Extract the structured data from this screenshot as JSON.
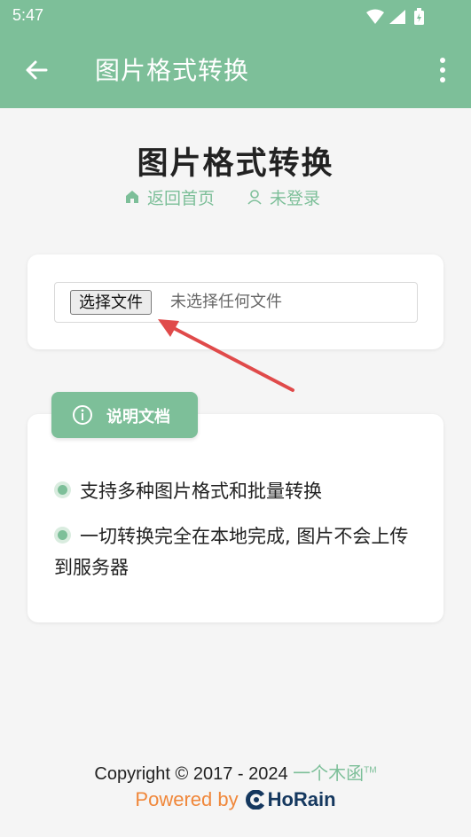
{
  "status_bar": {
    "time": "5:47"
  },
  "app_bar": {
    "title": "图片格式转换"
  },
  "page": {
    "title": "图片格式转换",
    "nav_home": "返回首页",
    "nav_login": "未登录"
  },
  "file_picker": {
    "button_label": "选择文件",
    "status": "未选择任何文件"
  },
  "docs": {
    "badge_label": "说明文档",
    "items": [
      "支持多种图片格式和批量转换",
      "一切转换完全在本地完成, 图片不会上传到服务器"
    ]
  },
  "footer": {
    "copyright": "Copyright © 2017 - 2024",
    "brand": "一个木函",
    "trademark": "TM",
    "powered_by": "Powered by",
    "company": "HoRain"
  },
  "colors": {
    "accent": "#7dbf99",
    "powered": "#f0873a",
    "company": "#15385f",
    "arrow": "#e04a4a"
  },
  "icons": [
    "wifi-icon",
    "signal-icon",
    "battery-icon",
    "back-arrow-icon",
    "more-vert-icon",
    "home-icon",
    "user-icon",
    "info-icon",
    "horain-logo-icon",
    "pointer-arrow-icon"
  ]
}
